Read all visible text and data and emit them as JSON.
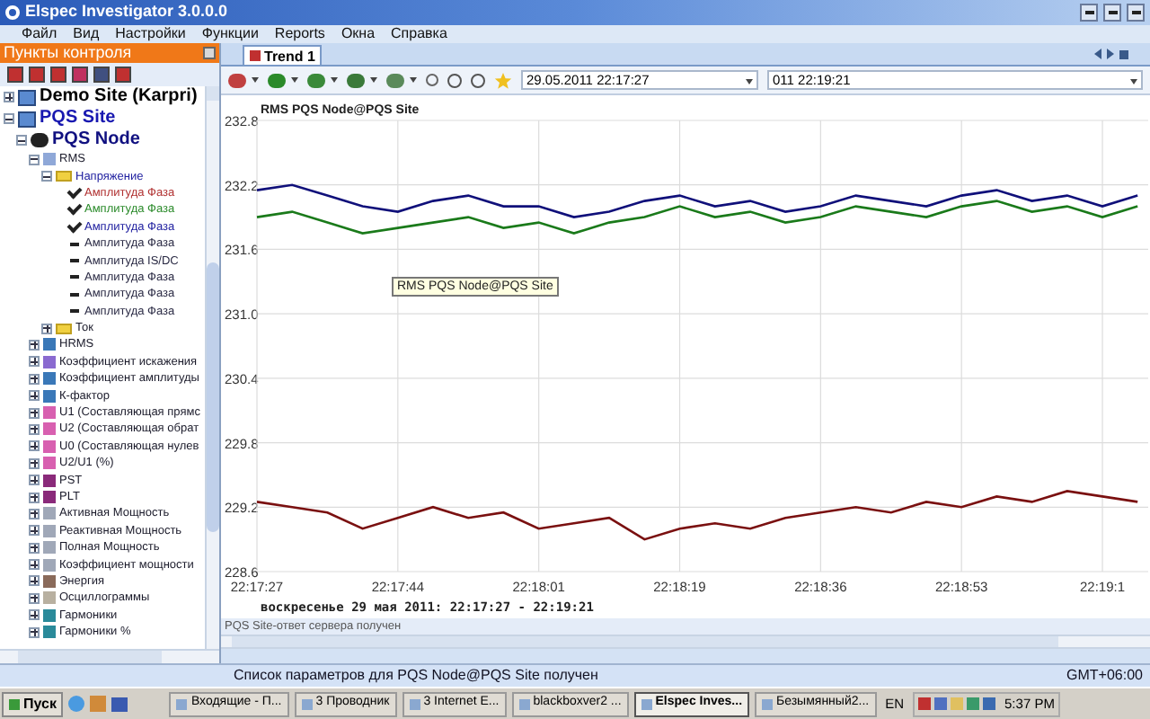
{
  "window": {
    "title": "Elspec Investigator 3.0.0.0"
  },
  "menu": [
    "Файл",
    "Вид",
    "Настройки",
    "Функции",
    "Reports",
    "Окна",
    "Справка"
  ],
  "sidebar": {
    "title": "Пункты контроля",
    "tree": [
      {
        "label": "Demo Site (Karpri)",
        "kind": "site",
        "connected": false,
        "expanded": false
      },
      {
        "label": "PQS Site",
        "kind": "site",
        "connected": true,
        "expanded": true,
        "children": [
          {
            "label": "PQS Node",
            "kind": "node",
            "expanded": true,
            "children": [
              {
                "label": "RMS",
                "kind": "param",
                "color": "#8fa8d8",
                "expanded": true,
                "children": [
                  {
                    "label": "Напряжение",
                    "kind": "folder",
                    "expanded": true,
                    "children": [
                      {
                        "label": "Амплитуда Фаза",
                        "kind": "channel",
                        "checked": true,
                        "color": "#b03030"
                      },
                      {
                        "label": "Амплитуда Фаза",
                        "kind": "channel",
                        "checked": true,
                        "color": "#2a8a2a"
                      },
                      {
                        "label": "Амплитуда Фаза",
                        "kind": "channel",
                        "checked": true,
                        "color": "#2020a0"
                      },
                      {
                        "label": "Амплитуда Фаза",
                        "kind": "channel",
                        "checked": false,
                        "color": "#2a2a44"
                      },
                      {
                        "label": "Амплитуда IS/DC",
                        "kind": "channel",
                        "checked": false,
                        "color": "#2a2a44"
                      },
                      {
                        "label": "Амплитуда Фаза",
                        "kind": "channel",
                        "checked": false,
                        "color": "#2a2a44"
                      },
                      {
                        "label": "Амплитуда Фаза",
                        "kind": "channel",
                        "checked": false,
                        "color": "#2a2a44"
                      },
                      {
                        "label": "Амплитуда Фаза",
                        "kind": "channel",
                        "checked": false,
                        "color": "#2a2a44"
                      }
                    ]
                  },
                  {
                    "label": "Ток",
                    "kind": "folder",
                    "expanded": false
                  }
                ]
              },
              {
                "label": "HRMS",
                "kind": "param",
                "color": "#3a78b8",
                "expanded": false
              },
              {
                "label": "Коэффициент искажения",
                "kind": "param",
                "color": "#8a6ad0",
                "expanded": false
              },
              {
                "label": "Коэффициент амплитуды",
                "kind": "param",
                "color": "#3a78b8",
                "expanded": false
              },
              {
                "label": "К-фактор",
                "kind": "param",
                "color": "#3a78b8",
                "expanded": false
              },
              {
                "label": "U1 (Составляющая прямс",
                "kind": "param",
                "color": "#d860b0",
                "expanded": false
              },
              {
                "label": "U2 (Составляющая обрат",
                "kind": "param",
                "color": "#d860b0",
                "expanded": false
              },
              {
                "label": "U0 (Составляющая нулев",
                "kind": "param",
                "color": "#d860b0",
                "expanded": false
              },
              {
                "label": "U2/U1 (%)",
                "kind": "param",
                "color": "#d860b0",
                "expanded": false
              },
              {
                "label": "PST",
                "kind": "param",
                "color": "#8a2a7a",
                "expanded": false
              },
              {
                "label": "PLT",
                "kind": "param",
                "color": "#8a2a7a",
                "expanded": false
              },
              {
                "label": "Активная Мощность",
                "kind": "param",
                "color": "#a0a8b8",
                "expanded": false
              },
              {
                "label": "Реактивная Мощность",
                "kind": "param",
                "color": "#a0a8b8",
                "expanded": false
              },
              {
                "label": "Полная Мощность",
                "kind": "param",
                "color": "#a0a8b8",
                "expanded": false
              },
              {
                "label": "Коэффициент мощности",
                "kind": "param",
                "color": "#a0a8b8",
                "expanded": false
              },
              {
                "label": "Энергия",
                "kind": "param",
                "color": "#8a6a5a",
                "expanded": false
              },
              {
                "label": "Осциллограммы",
                "kind": "param",
                "color": "#b8b0a0",
                "expanded": false
              },
              {
                "label": "Гармоники",
                "kind": "param",
                "color": "#2a8a9a",
                "expanded": false
              },
              {
                "label": "Гармоники %",
                "kind": "param",
                "color": "#2a8a9a",
                "expanded": false
              }
            ]
          }
        ]
      }
    ]
  },
  "tabs": [
    {
      "label": "Trend 1",
      "selected": true
    }
  ],
  "range": {
    "start": "29.05.2011 22:17:27",
    "end": "011 22:19:21"
  },
  "chart": {
    "tooltip": "RMS PQS Node@PQS Site",
    "chart_data": {
      "type": "line",
      "title": "RMS PQS Node@PQS Site",
      "grid": true,
      "ylim": [
        228.6,
        232.8
      ],
      "categories": [
        "22:17:27",
        null,
        null,
        null,
        "22:17:44",
        null,
        null,
        null,
        "22:18:01",
        null,
        null,
        null,
        "22:18:19",
        null,
        null,
        null,
        "22:18:36",
        null,
        null,
        null,
        "22:18:53",
        null,
        null,
        null,
        "22:19:1",
        null
      ],
      "yticks": [
        228.6,
        229.2,
        229.8,
        230.4,
        {
          "value": 231,
          "label": "231.0"
        },
        231.6,
        232.2,
        232.8
      ],
      "series": [
        {
          "color": "#10107a",
          "values": [
            232.15,
            232.2,
            232.1,
            232.0,
            231.95,
            232.05,
            232.1,
            232.0,
            232.0,
            231.9,
            231.95,
            232.05,
            232.1,
            232.0,
            232.05,
            231.95,
            232.0,
            232.1,
            232.05,
            232.0,
            232.1,
            232.15,
            232.05,
            232.1,
            232.0,
            232.1
          ]
        },
        {
          "color": "#1a7a1a",
          "values": [
            231.9,
            231.95,
            231.85,
            231.75,
            231.8,
            231.85,
            231.9,
            231.8,
            231.85,
            231.75,
            231.85,
            231.9,
            232.0,
            231.9,
            231.95,
            231.85,
            231.9,
            232.0,
            231.95,
            231.9,
            232.0,
            232.05,
            231.95,
            232.0,
            231.9,
            232.0
          ]
        },
        {
          "color": "#7a1010",
          "values": [
            229.25,
            229.2,
            229.15,
            229.0,
            229.1,
            229.2,
            229.1,
            229.15,
            229.0,
            229.05,
            229.1,
            228.9,
            229.0,
            229.05,
            229.0,
            229.1,
            229.15,
            229.2,
            229.15,
            229.25,
            229.2,
            229.3,
            229.25,
            229.35,
            229.3,
            229.25
          ]
        }
      ]
    },
    "caption": "воскресенье 29 мая 2011: 22:17:27 - 22:19:21"
  },
  "message": "PQS Site-ответ сервера получен",
  "status_bar": {
    "text": "Список параметров для PQS Node@PQS Site получен",
    "timezone": "GMT+06:00"
  },
  "taskbar": {
    "start": "Пуск",
    "tasks": [
      {
        "label": "Входящие - П...",
        "selected": false
      },
      {
        "label": "3 Проводник",
        "selected": false
      },
      {
        "label": "3 Internet E...",
        "selected": false
      },
      {
        "label": "blackboxver2 ...",
        "selected": false
      },
      {
        "label": "Elspec Inves...",
        "selected": true
      },
      {
        "label": "Безымянный2...",
        "selected": false
      }
    ],
    "language": "EN",
    "clock": "5:37 PM"
  }
}
